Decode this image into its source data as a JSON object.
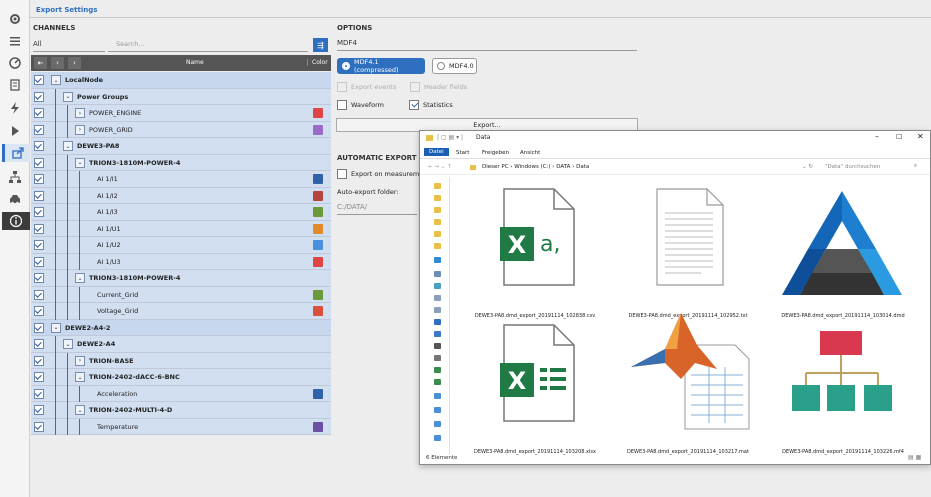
{
  "header": {
    "title": "Export Settings"
  },
  "channels": {
    "label": "CHANNELS",
    "filter_value": "All",
    "search_placeholder": "Search...",
    "col_name": "Name",
    "col_color": "Color",
    "rows": [
      {
        "name": "LocalNode",
        "level": 0,
        "bold": true,
        "expanded": true,
        "color": ""
      },
      {
        "name": "Power Groups",
        "level": 1,
        "bold": true,
        "expanded": true,
        "color": ""
      },
      {
        "name": "POWER_ENGINE",
        "level": 2,
        "bold": false,
        "expanded": false,
        "color": "#e04545"
      },
      {
        "name": "POWER_GRID",
        "level": 2,
        "bold": false,
        "expanded": false,
        "color": "#9b6bc9"
      },
      {
        "name": "DEWE3-PA8",
        "level": 1,
        "bold": true,
        "expanded": true,
        "color": ""
      },
      {
        "name": "TRION3-1810M-POWER-4",
        "level": 2,
        "bold": true,
        "expanded": true,
        "color": ""
      },
      {
        "name": "AI 1/I1",
        "level": 3,
        "bold": false,
        "expanded": null,
        "color": "#2f62a8"
      },
      {
        "name": "AI 1/I2",
        "level": 3,
        "bold": false,
        "expanded": null,
        "color": "#b5443e"
      },
      {
        "name": "AI 1/I3",
        "level": 3,
        "bold": false,
        "expanded": null,
        "color": "#6a9a3a"
      },
      {
        "name": "AI 1/U1",
        "level": 3,
        "bold": false,
        "expanded": null,
        "color": "#e08a2a"
      },
      {
        "name": "AI 1/U2",
        "level": 3,
        "bold": false,
        "expanded": null,
        "color": "#4a8fe0"
      },
      {
        "name": "AI 1/U3",
        "level": 3,
        "bold": false,
        "expanded": null,
        "color": "#e04545"
      },
      {
        "name": "TRION3-1810M-POWER-4",
        "level": 2,
        "bold": true,
        "expanded": true,
        "color": ""
      },
      {
        "name": "Current_Grid",
        "level": 3,
        "bold": false,
        "expanded": null,
        "color": "#6a9a3a"
      },
      {
        "name": "Voltage_Grid",
        "level": 3,
        "bold": false,
        "expanded": null,
        "color": "#d9503a"
      },
      {
        "name": "DEWE2-A4-2",
        "level": 0,
        "bold": true,
        "expanded": true,
        "color": ""
      },
      {
        "name": "DEWE2-A4",
        "level": 1,
        "bold": true,
        "expanded": true,
        "color": ""
      },
      {
        "name": "TRION-BASE",
        "level": 2,
        "bold": true,
        "expanded": false,
        "color": ""
      },
      {
        "name": "TRION-2402-dACC-6-BNC",
        "level": 2,
        "bold": true,
        "expanded": true,
        "color": ""
      },
      {
        "name": "Acceleration",
        "level": 3,
        "bold": false,
        "expanded": null,
        "color": "#2f62a8"
      },
      {
        "name": "TRION-2402-MULTI-4-D",
        "level": 2,
        "bold": true,
        "expanded": true,
        "color": ""
      },
      {
        "name": "Temperature",
        "level": 3,
        "bold": false,
        "expanded": null,
        "color": "#6b4fa3"
      }
    ]
  },
  "options": {
    "label": "OPTIONS",
    "format_value": "MDF4",
    "radio_compressed": "MDF4.1 (compressed)",
    "radio_plain": "MDF4.0",
    "export_events": "Export events",
    "header_fields": "Header fields",
    "waveform": "Waveform",
    "statistics": "Statistics",
    "export_button": "Export..."
  },
  "automatic": {
    "label": "AUTOMATIC EXPORT",
    "export_on_measurement": "Export on measuremen",
    "folder_label": "Auto-export folder:",
    "folder_value": "C:/DATA/"
  },
  "explorer": {
    "title": "Data",
    "tabs": [
      "Datei",
      "Start",
      "Freigeben",
      "Ansicht"
    ],
    "path": "Dieser PC  ›  Windows (C:)  ›  DATA  ›  Data",
    "search_placeholder": "\"Data\" durchsuchen",
    "status": "6 Elemente",
    "files": [
      {
        "name": "DEWE3-PA8.dmd_export_20191114_102838.csv",
        "icon": "excel-csv-icon"
      },
      {
        "name": "DEWE3-PA8.dmd_export_20191114_102952.txt",
        "icon": "text-file-icon"
      },
      {
        "name": "DEWE3-PA8.dmd_export_20191114_103014.dmd",
        "icon": "dewesoft-icon"
      },
      {
        "name": "DEWE3-PA8.dmd_export_20191114_103208.xlsx",
        "icon": "excel-xlsx-icon"
      },
      {
        "name": "DEWE3-PA8.dmd_export_20191114_103217.mat",
        "icon": "matlab-icon"
      },
      {
        "name": "DEWE3-PA8.dmd_export_20191114_103226.mf4",
        "icon": "mdf-icon"
      }
    ]
  }
}
